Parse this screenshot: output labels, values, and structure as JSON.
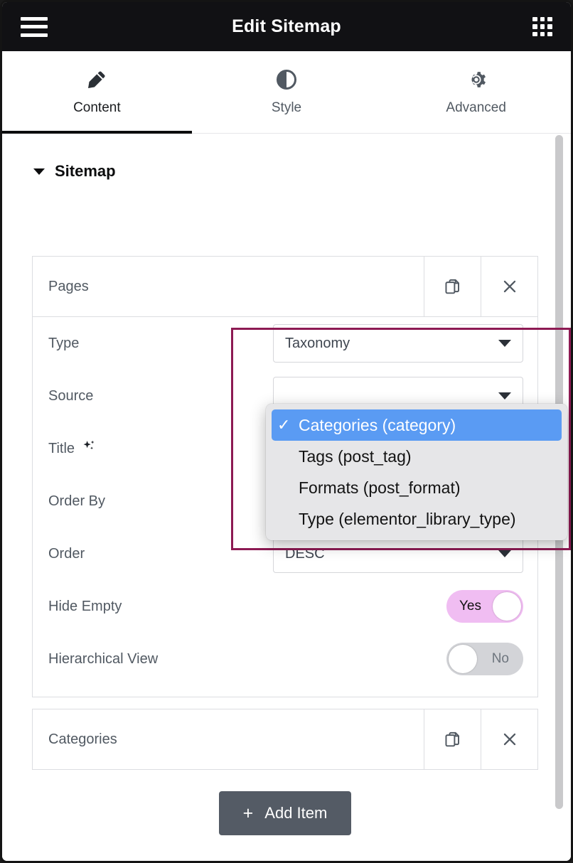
{
  "window": {
    "title": "Edit Sitemap",
    "menu_icon": "hamburger-icon",
    "apps_icon": "grid-apps-icon"
  },
  "tabs": [
    {
      "label": "Content",
      "icon": "pencil-icon",
      "active": true
    },
    {
      "label": "Style",
      "icon": "contrast-icon",
      "active": false
    },
    {
      "label": "Advanced",
      "icon": "gear-icon",
      "active": false
    }
  ],
  "section": {
    "title": "Sitemap",
    "caret": "caret-down-icon"
  },
  "repeater": {
    "items": [
      {
        "title": "Pages",
        "duplicate_icon": "duplicate-icon",
        "remove_icon": "close-icon",
        "expanded": true,
        "fields": [
          {
            "name": "type",
            "label": "Type",
            "control": "select",
            "value": "Taxonomy"
          },
          {
            "name": "source",
            "label": "Source",
            "control": "select",
            "value": ""
          },
          {
            "name": "title",
            "label": "Title",
            "control": "select",
            "value": "",
            "badge": "ai-sparkle-icon"
          },
          {
            "name": "order_by",
            "label": "Order By",
            "control": "select",
            "value": ""
          },
          {
            "name": "order",
            "label": "Order",
            "control": "select",
            "value": "DESC"
          },
          {
            "name": "hide_empty",
            "label": "Hide Empty",
            "control": "switch",
            "value": "Yes",
            "on": true
          },
          {
            "name": "hierarchy",
            "label": "Hierarchical View",
            "control": "switch",
            "value": "No",
            "on": false
          }
        ]
      },
      {
        "title": "Categories",
        "duplicate_icon": "duplicate-icon",
        "remove_icon": "close-icon",
        "expanded": false,
        "fields": []
      }
    ],
    "add_button": {
      "label": "Add Item",
      "plus": "+"
    }
  },
  "dropdown": {
    "open": true,
    "check_glyph": "✓",
    "options": [
      {
        "label": "Categories (category)",
        "selected": true
      },
      {
        "label": "Tags (post_tag)",
        "selected": false
      },
      {
        "label": "Formats (post_format)",
        "selected": false
      },
      {
        "label": "Type (elementor_library_type)",
        "selected": false
      }
    ]
  },
  "colors": {
    "topbar_bg": "#111114",
    "highlight_border": "#8d1a53",
    "dropdown_selected": "#5a9bf3",
    "switch_on": "#f0bdf2",
    "switch_off": "#d3d4d8",
    "add_button_bg": "#545b65"
  }
}
